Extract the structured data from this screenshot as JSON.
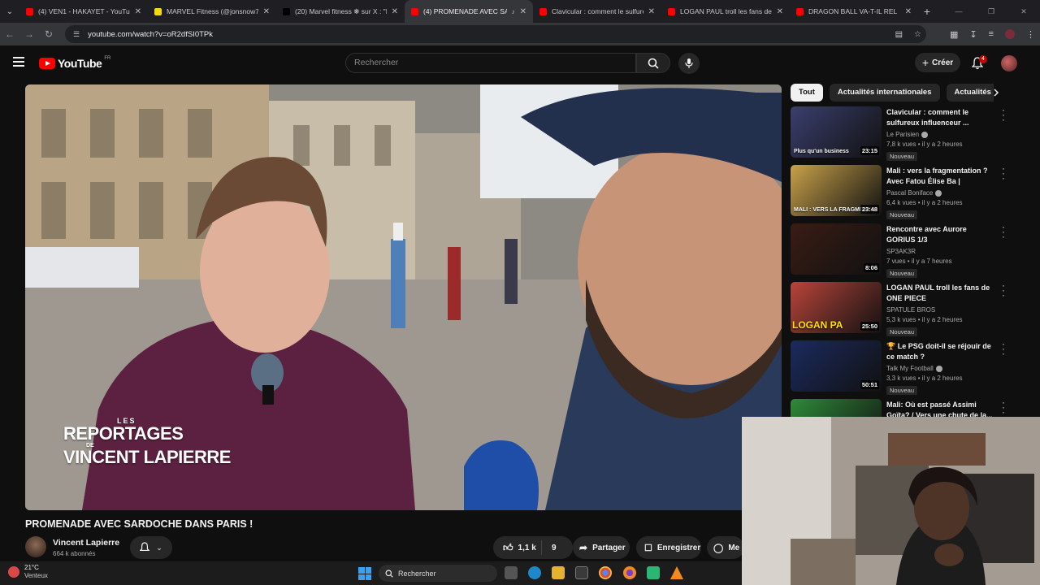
{
  "browser": {
    "tabs": [
      {
        "title": "(4) VEN1 - HAKAYET - YouTube",
        "favicon_color": "#ff0000",
        "active": false
      },
      {
        "title": "MARVEL Fitness (@jonsnow78",
        "favicon_color": "#f5d90a",
        "active": false
      },
      {
        "title": "(20) Marvel fitness ❋ sur X : \"M",
        "favicon_color": "#000000",
        "active": false
      },
      {
        "title": "(4) PROMENADE AVEC SAR",
        "favicon_color": "#ff0000",
        "active": true
      },
      {
        "title": "Clavicular : comment le sulfureu",
        "favicon_color": "#ff0000",
        "active": false
      },
      {
        "title": "LOGAN PAUL troll les fans de O",
        "favicon_color": "#ff0000",
        "active": false
      },
      {
        "title": "DRAGON BALL VA-T-IL REL",
        "favicon_color": "#ff0000",
        "active": false
      }
    ],
    "new_tab_icon": "plus-icon",
    "url": "youtube.com/watch?v=oR2dfSI0TPk"
  },
  "masthead": {
    "logo_text": "YouTube",
    "logo_region": "FR",
    "search_placeholder": "Rechercher",
    "create_label": "Créer",
    "notification_count": "4"
  },
  "video": {
    "watermark_les": "LES",
    "watermark_line1": "REPORTAGES",
    "watermark_de": "DE",
    "watermark_line2": "VINCENT LAPIERRE",
    "title": "PROMENADE AVEC SARDOCHE DANS PARIS !",
    "channel_name": "Vincent Lapierre",
    "channel_subs": "664 k abonnés",
    "likes": "1,1 k",
    "dislikes": "9",
    "share_label": "Partager",
    "save_label": "Enregistrer",
    "more_label": "Me"
  },
  "sidebar": {
    "chips": [
      "Tout",
      "Actualités internationales",
      "Actualités sp"
    ],
    "items": [
      {
        "title": "Clavicular : comment le sulfureux influenceur ...",
        "channel": "Le Parisien",
        "verified": true,
        "stats": "7,8 k vues • il y a 2 heures",
        "badge": "Nouveau",
        "duration": "23:15",
        "thumb_text": "Plus qu'un business",
        "thumb_color": "#3a3f6e"
      },
      {
        "title": "Mali : vers la fragmentation ? Avec Fatou Élise Ba | Entretien...",
        "channel": "Pascal Boniface",
        "verified": true,
        "stats": "6,4 k vues • il y a 2 heures",
        "badge": "Nouveau",
        "duration": "23:48",
        "thumb_text": "MALI : VERS LA FRAGMENTA",
        "thumb_color": "#c9a24a"
      },
      {
        "title": "Rencontre avec Aurore GORIUS 1/3",
        "channel": "SP3AK3R",
        "verified": false,
        "stats": "7 vues • il y a 7 heures",
        "badge": "Nouveau",
        "duration": "8:06",
        "thumb_text": "",
        "thumb_color": "#3a1c14"
      },
      {
        "title": "LOGAN PAUL troll les fans de ONE PIECE",
        "channel": "SPATULE BROS",
        "verified": false,
        "stats": "5,3 k vues • il y a 2 heures",
        "badge": "Nouveau",
        "duration": "25:50",
        "thumb_big": "LOGAN PA",
        "thumb_color": "#b9443a"
      },
      {
        "title": "🏆 Le PSG doit-il se réjouir de ce match ?",
        "channel": "Talk My Football",
        "verified": true,
        "stats": "3,3 k vues • il y a 2 heures",
        "badge": "Nouveau",
        "duration": "50:51",
        "thumb_text": "",
        "thumb_color": "#1b2a5e"
      },
      {
        "title": "Mali: Où est passé Assimi Goïta? / Vers une chute de la...",
        "channel": "",
        "verified": false,
        "stats": "",
        "badge": "",
        "duration": "",
        "thumb_text": "",
        "thumb_color": "#2f8a3a"
      }
    ]
  },
  "taskbar": {
    "temperature": "21°C",
    "condition": "Venteux",
    "search_placeholder": "Rechercher"
  }
}
